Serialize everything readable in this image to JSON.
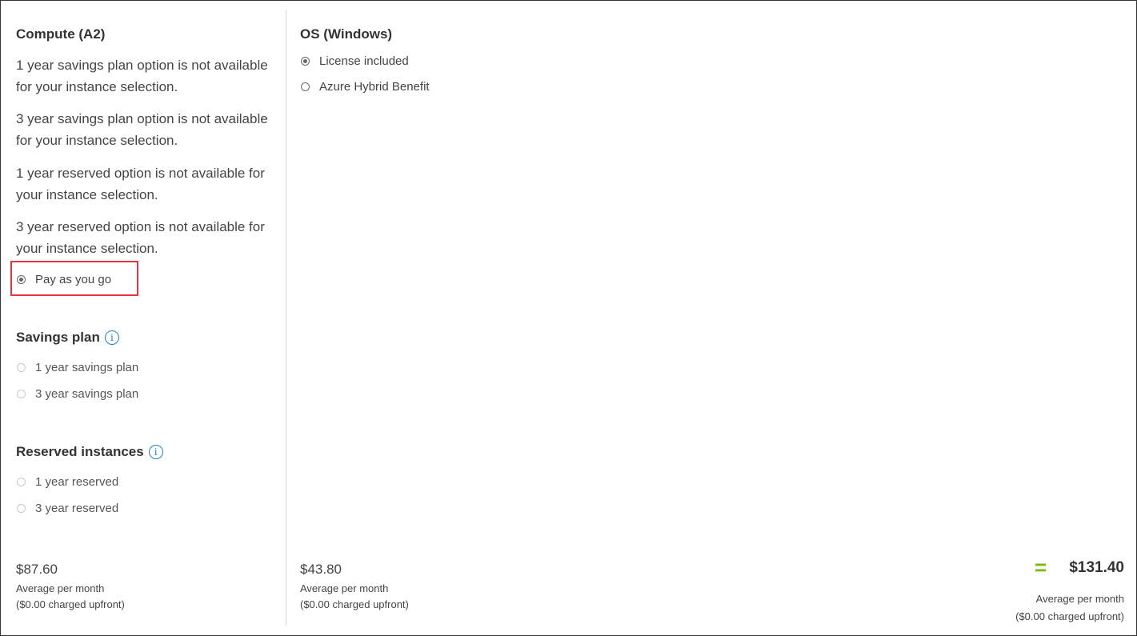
{
  "compute": {
    "heading": "Compute (A2)",
    "notes": [
      "1 year savings plan option is not available for your instance selection.",
      "3 year savings plan option is not available for your instance selection.",
      "1 year reserved option is not available for your instance selection.",
      "3 year reserved option is not available for your instance selection."
    ],
    "payg_label": "Pay as you go",
    "price": "$87.60",
    "price_caption": "Average per month",
    "upfront": "($0.00 charged upfront)"
  },
  "savings_plan": {
    "heading": "Savings plan",
    "options": [
      "1 year savings plan",
      "3 year savings plan"
    ]
  },
  "reserved": {
    "heading": "Reserved instances",
    "options": [
      "1 year reserved",
      "3 year reserved"
    ]
  },
  "os": {
    "heading": "OS (Windows)",
    "options": [
      "License included",
      "Azure Hybrid Benefit"
    ],
    "selected": "License included",
    "price": "$43.80",
    "price_caption": "Average per month",
    "upfront": "($0.00 charged upfront)"
  },
  "total": {
    "symbol": "=",
    "value": "$131.40",
    "caption": "Average per month",
    "upfront": "($0.00 charged upfront)"
  },
  "colors": {
    "accent_green": "#7bb800",
    "highlight_red": "#e8353b",
    "info_blue": "#1f7fcf"
  },
  "icons": {
    "info": "info-icon"
  }
}
